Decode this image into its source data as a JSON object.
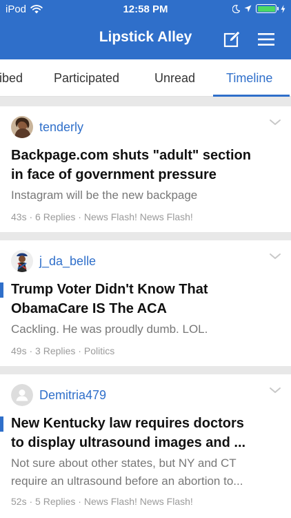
{
  "status_bar": {
    "carrier": "iPod",
    "time": "12:58 PM",
    "wifi_icon": "wifi-icon",
    "moon_icon": "moon-icon",
    "location_icon": "location-arrow-icon",
    "battery_icon": "battery-charging-icon",
    "battery_level": 1.0
  },
  "nav": {
    "title": "Lipstick Alley",
    "compose_icon": "compose-icon",
    "menu_icon": "hamburger-menu-icon"
  },
  "tabs": [
    {
      "label": "ibed",
      "active": false
    },
    {
      "label": "Participated",
      "active": false
    },
    {
      "label": "Unread",
      "active": false
    },
    {
      "label": "Timeline",
      "active": true
    }
  ],
  "colors": {
    "brand": "#2f6fca",
    "unread_marker": "#2f6fca",
    "separator": "#e8e8e8"
  },
  "threads": [
    {
      "author": "tenderly",
      "avatar": "user-photo-avatar",
      "title_lines": [
        "Backpage.com shuts \"adult\" section",
        "in face of government pressure"
      ],
      "preview_lines": [
        "Instagram will be the new backpage"
      ],
      "time": "43s",
      "replies": "6 Replies",
      "forum": "News Flash! News Flash!",
      "unread": false
    },
    {
      "author": "j_da_belle",
      "avatar": "user-illustration-avatar",
      "title_lines": [
        "Trump Voter Didn't Know That",
        "ObamaCare IS The ACA"
      ],
      "preview_lines": [
        "Cackling. He was proudly dumb. LOL."
      ],
      "time": "49s",
      "replies": "3 Replies",
      "forum": "Politics",
      "unread": true
    },
    {
      "author": "Demitria479",
      "avatar": "default-user-avatar",
      "title_lines": [
        "New Kentucky law requires doctors",
        "to display ultrasound images and ..."
      ],
      "preview_lines": [
        "Not sure about other states, but NY and CT",
        "require an ultrasound before an abortion to..."
      ],
      "time": "52s",
      "replies": "5 Replies",
      "forum": "News Flash! News Flash!",
      "unread": true
    }
  ],
  "meta_separator": " · "
}
